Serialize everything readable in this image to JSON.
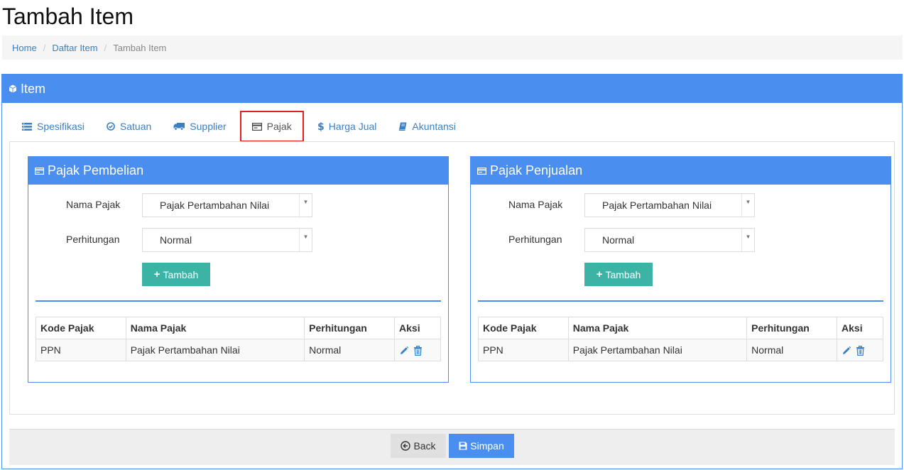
{
  "page_title": "Tambah Item",
  "breadcrumb": {
    "home": "Home",
    "list": "Daftar Item",
    "current": "Tambah Item",
    "separator": "/"
  },
  "panel": {
    "title": "Item",
    "icon": "cube-icon"
  },
  "tabs": [
    {
      "label": "Spesifikasi",
      "icon": "list-icon"
    },
    {
      "label": "Satuan",
      "icon": "check-circle-icon"
    },
    {
      "label": "Supplier",
      "icon": "truck-icon"
    },
    {
      "label": "Pajak",
      "icon": "credit-card-icon",
      "active": true
    },
    {
      "label": "Harga Jual",
      "icon": "dollar-icon"
    },
    {
      "label": "Akuntansi",
      "icon": "book-icon"
    }
  ],
  "purchase_tax": {
    "title": "Pajak Pembelian",
    "nama_label": "Nama Pajak",
    "nama_value": "Pajak Pertambahan Nilai",
    "perhitungan_label": "Perhitungan",
    "perhitungan_value": "Normal",
    "add_label": "Tambah",
    "table": {
      "headers": [
        "Kode Pajak",
        "Nama Pajak",
        "Perhitungan",
        "Aksi"
      ],
      "rows": [
        {
          "kode": "PPN",
          "nama": "Pajak Pertambahan Nilai",
          "perhitungan": "Normal"
        }
      ]
    }
  },
  "sales_tax": {
    "title": "Pajak Penjualan",
    "nama_label": "Nama Pajak",
    "nama_value": "Pajak Pertambahan Nilai",
    "perhitungan_label": "Perhitungan",
    "perhitungan_value": "Normal",
    "add_label": "Tambah",
    "table": {
      "headers": [
        "Kode Pajak",
        "Nama Pajak",
        "Perhitungan",
        "Aksi"
      ],
      "rows": [
        {
          "kode": "PPN",
          "nama": "Pajak Pertambahan Nilai",
          "perhitungan": "Normal"
        }
      ]
    }
  },
  "footer": {
    "back_label": "Back",
    "save_label": "Simpan"
  },
  "colors": {
    "primary": "#4a8ff0",
    "teal": "#3bb3a5",
    "link": "#3a7fc1",
    "active_tab_border": "#e02020"
  }
}
